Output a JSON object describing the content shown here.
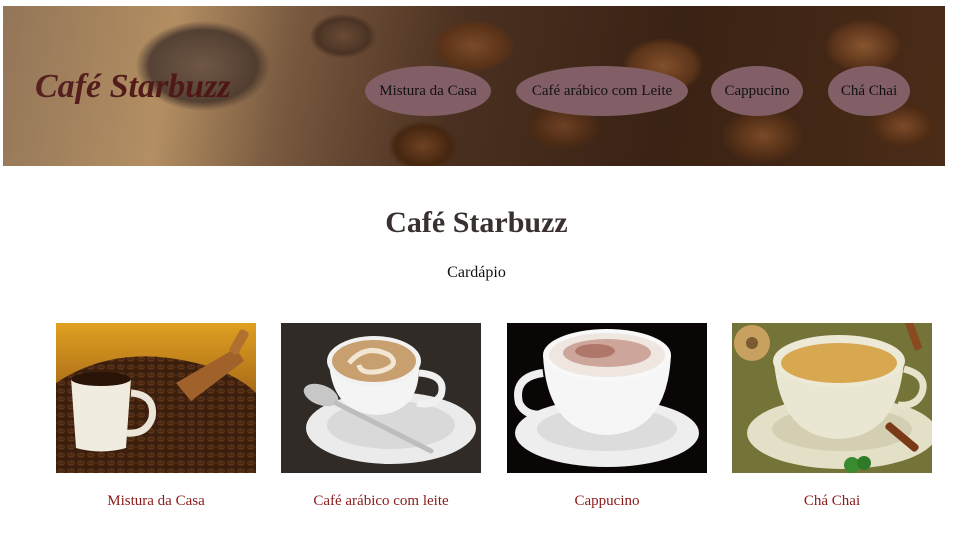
{
  "header": {
    "logo": "Café Starbuzz",
    "nav": [
      {
        "label": "Mistura da Casa"
      },
      {
        "label": "Café arábico com Leite"
      },
      {
        "label": "Cappucino"
      },
      {
        "label": "Chá Chai"
      }
    ]
  },
  "main": {
    "title": "Café Starbuzz",
    "subtitle": "Cardápio",
    "products": [
      {
        "name": "Mistura da Casa",
        "icon": "coffee-cup-beans-photo"
      },
      {
        "name": "Café arábico com leite",
        "icon": "latte-cup-spoon-photo"
      },
      {
        "name": "Cappucino",
        "icon": "cappuccino-cup-photo"
      },
      {
        "name": "Chá Chai",
        "icon": "chai-tea-cup-photo"
      }
    ]
  },
  "colors": {
    "nav_bg": "#825f66",
    "logo": "#4a1010",
    "caption": "#8b1a1a",
    "title": "#3a3030"
  }
}
